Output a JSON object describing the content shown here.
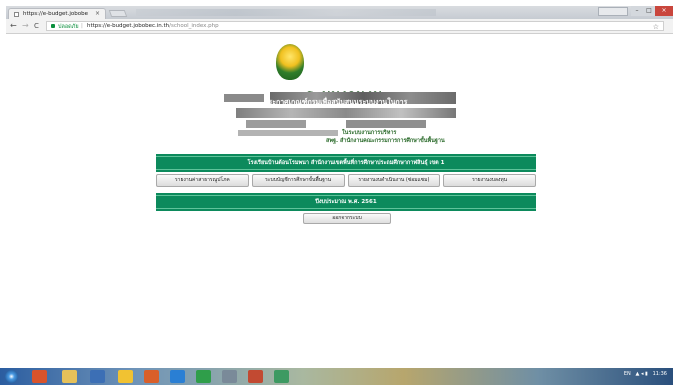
{
  "browser": {
    "tab_title": "https://e-budget.jobobe",
    "tab_close": "×",
    "nav_back": "←",
    "nav_forward": "→",
    "nav_reload": "C",
    "secure_label": "ปลอดภัย",
    "url_separator": "|",
    "url_host": "https://e-budget.jobobec.in.th",
    "url_path": "/school_index.php",
    "bookmark_star": "☆",
    "win_min": "–",
    "win_max": "□",
    "win_close": "×"
  },
  "header": {
    "system_title": "ระบบงานงบ",
    "line1": "ประกาศเกณฑ์กรมเพื่อสนับสนุนระบบงานในการ",
    "line2": "ในระบบงานการบริหาร",
    "agency": "สพฐ.  สำนักงานคณะกรรมการการศึกษาขั้นพื้นฐาน"
  },
  "school_bar": {
    "text": "โรงเรียนบ้านต้อนโรมพนา   สำนักงานเขตพื้นที่การศึกษาประถมศึกษากาฬสินธุ์ เขต 1"
  },
  "menu": {
    "items": [
      {
        "label": "รายงานค่าสาธารณูปโภค"
      },
      {
        "label": "ระบบบัญชีการศึกษาขั้นพื้นฐาน"
      },
      {
        "label": "รายงานงบดำเนินงาน (ซ่อมแซม)"
      },
      {
        "label": "รายงานงบลงทุน"
      }
    ]
  },
  "year_bar": {
    "text": "ปีงบประมาณ พ.ศ. 2561"
  },
  "logout_label": "ออกจากระบบ",
  "taskbar": {
    "tray_lang": "EN",
    "clock": "11:36"
  },
  "colors": {
    "primary_green": "#0c8a5c",
    "header_green": "#1d4d1d",
    "secure_green": "#0a8f3c"
  }
}
